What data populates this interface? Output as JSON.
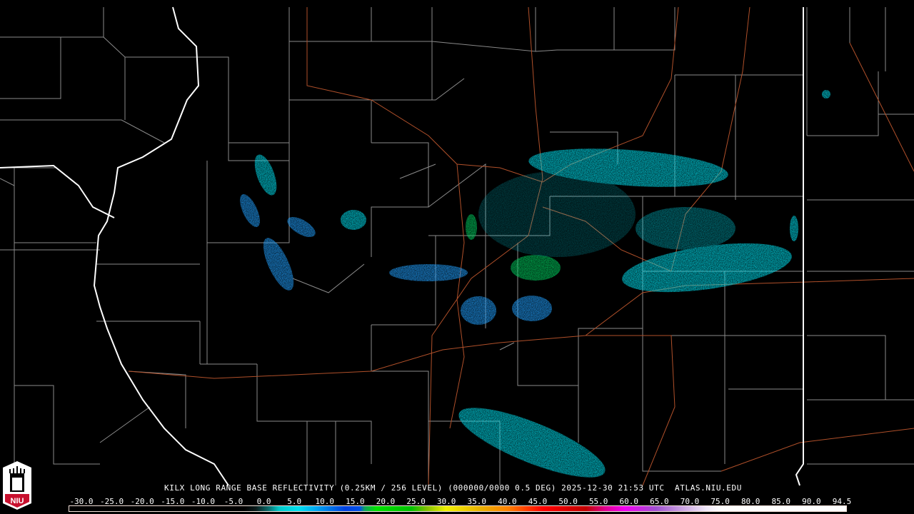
{
  "product": {
    "caption": "KILX LONG RANGE BASE REFLECTIVITY (0.25KM / 256 LEVEL) (000000/0000 0.5 DEG) 2025-12-30 21:53 UTC  ATLAS.NIU.EDU"
  },
  "legend": {
    "ticks": [
      "-30.0",
      "-25.0",
      "-20.0",
      "-15.0",
      "-10.0",
      "-5.0",
      "0.0",
      "5.0",
      "10.0",
      "15.0",
      "20.0",
      "25.0",
      "30.0",
      "35.0",
      "40.0",
      "45.0",
      "50.0",
      "55.0",
      "60.0",
      "65.0",
      "70.0",
      "75.0",
      "80.0",
      "85.0",
      "90.0",
      "94.5"
    ]
  },
  "logo": {
    "text": "NIU"
  },
  "colors": {
    "background": "#000000",
    "county": "#8a8a8a",
    "state": "#ffffff",
    "road": "#b0502a",
    "echo": "#00e8f0"
  }
}
